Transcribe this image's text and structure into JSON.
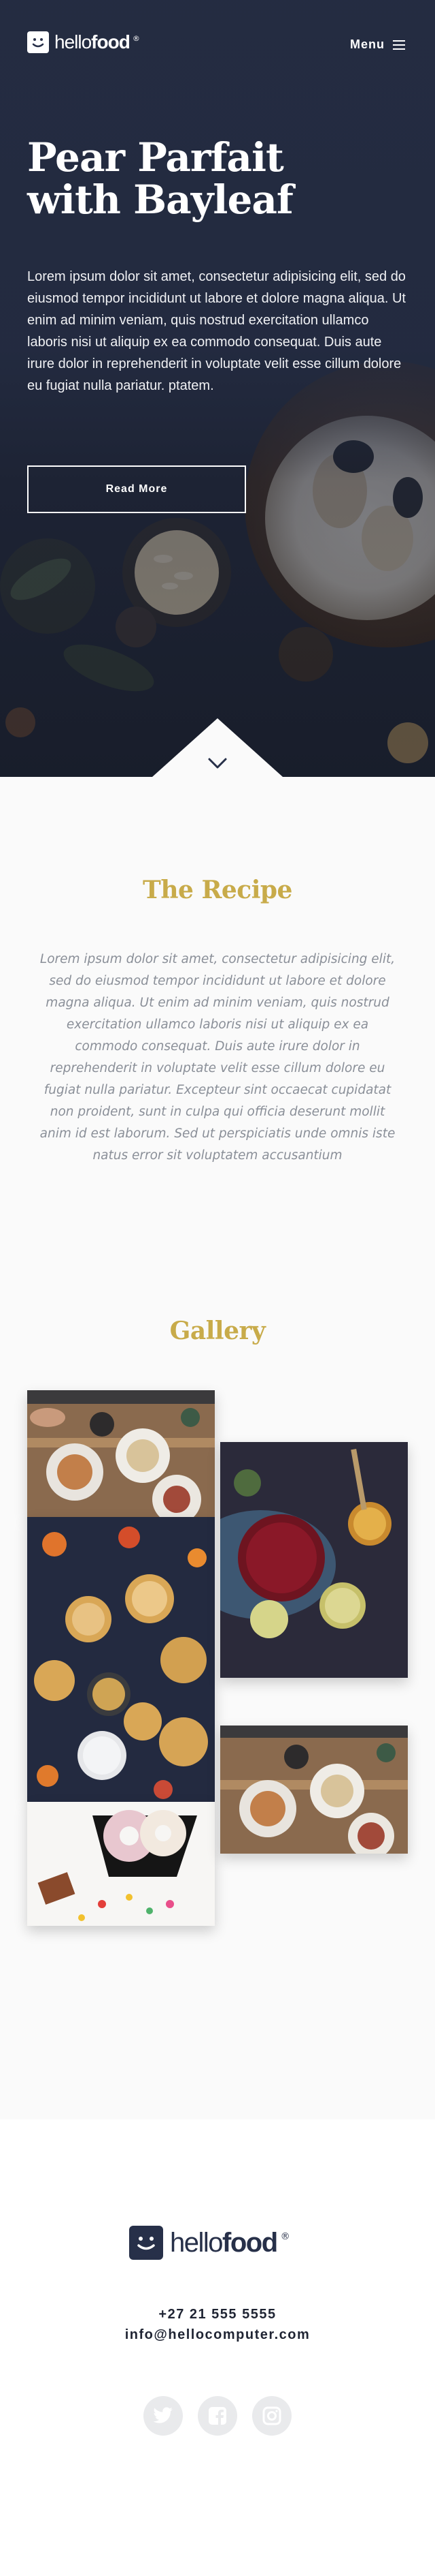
{
  "brand": {
    "name_light": "hello",
    "name_bold": "food",
    "reg_mark": "®"
  },
  "nav": {
    "menu_label": "Menu"
  },
  "hero": {
    "title_line1": "Pear Parfait",
    "title_line2": "with Bayleaf",
    "text": "Lorem ipsum dolor sit amet, consectetur adipisicing elit, sed do eiusmod tempor incididunt ut labore et dolore magna aliqua. Ut enim ad minim veniam, quis nostrud exercitation ullamco laboris nisi ut aliquip ex ea commodo consequat. Duis aute irure dolor in reprehenderit in voluptate velit esse cillum dolore eu fugiat nulla pariatur. ptatem.",
    "button_label": "Read More"
  },
  "recipe": {
    "title": "The Recipe",
    "text": "Lorem ipsum dolor sit amet, consectetur adipisicing elit, sed do eiusmod tempor incididunt ut labore et dolore magna aliqua. Ut enim ad minim veniam, quis nostrud exercitation ullamco laboris nisi ut aliquip ex ea commodo consequat. Duis aute irure dolor in reprehenderit in voluptate velit esse cillum dolore eu fugiat nulla pariatur. Excepteur sint occaecat cupidatat non proident, sunt in culpa qui officia deserunt mollit anim id est laborum. Sed ut perspiciatis unde omnis iste natus error sit voluptatem accusantium"
  },
  "gallery": {
    "title": "Gallery"
  },
  "footer": {
    "phone": "+27 21 555 5555",
    "email": "info@hellocomputer.com",
    "social": [
      "twitter-icon",
      "facebook-icon",
      "instagram-icon"
    ]
  },
  "colors": {
    "navy": "#273049",
    "gold": "#c8ab4a",
    "body_text": "#8a8f98"
  }
}
